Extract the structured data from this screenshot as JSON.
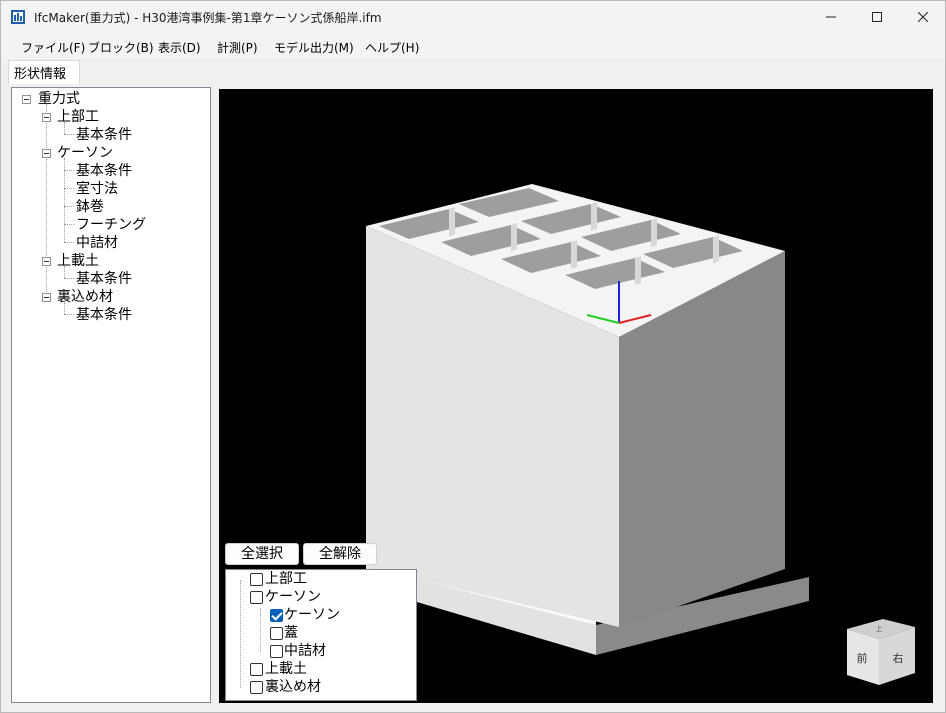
{
  "window": {
    "title": "IfcMaker(重力式) - H30港湾事例集-第1章ケーソン式係船岸.ifm"
  },
  "menu": [
    {
      "label": "ファイル(F)"
    },
    {
      "label": "ブロック(B)"
    },
    {
      "label": "表示(D)"
    },
    {
      "label": "計測(P)"
    },
    {
      "label": "モデル出力(M)"
    },
    {
      "label": "ヘルプ(H)"
    }
  ],
  "tabs": [
    {
      "label": "形状情報"
    }
  ],
  "tree": {
    "root": "重力式",
    "groups": [
      {
        "label": "上部工",
        "children": [
          "基本条件"
        ]
      },
      {
        "label": "ケーソン",
        "children": [
          "基本条件",
          "室寸法",
          "鉢巻",
          "フーチング",
          "中詰材"
        ]
      },
      {
        "label": "上載土",
        "children": [
          "基本条件"
        ]
      },
      {
        "label": "裏込め材",
        "children": [
          "基本条件"
        ]
      }
    ]
  },
  "buttons": {
    "select_all": "全選択",
    "deselect_all": "全解除"
  },
  "layers": [
    {
      "label": "上部工",
      "checked": false
    },
    {
      "label": "ケーソン",
      "checked": false
    },
    {
      "label": "ケーソン",
      "checked": true
    },
    {
      "label": "蓋",
      "checked": false
    },
    {
      "label": "中詰材",
      "checked": false
    },
    {
      "label": "上載土",
      "checked": false
    },
    {
      "label": "裏込め材",
      "checked": false
    }
  ],
  "viewcube": {
    "front": "前",
    "right": "右",
    "top": "上"
  },
  "colors": {
    "viewport_bg": "#000000",
    "caisson_light": "#e4e4e4",
    "caisson_dark": "#8a8a8a",
    "axis_x": "#e02020",
    "axis_y": "#20d020",
    "axis_z": "#2020e0",
    "checkbox_accent": "#005fb8"
  }
}
